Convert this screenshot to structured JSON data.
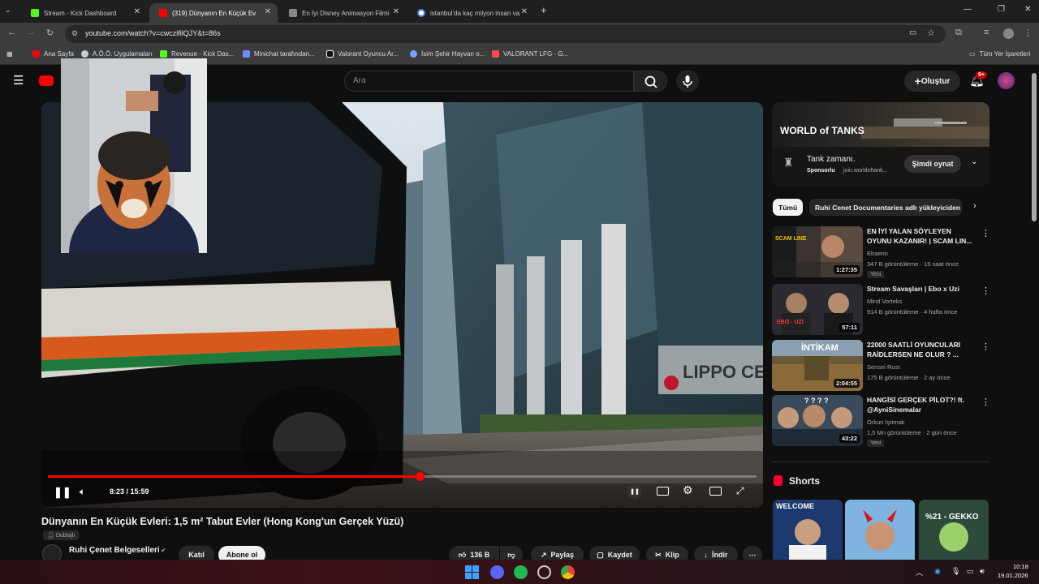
{
  "browser": {
    "tabs": [
      {
        "title": "Stream - Kick Dashboard",
        "color": "#53fc18",
        "active": false
      },
      {
        "title": "(319) Dünyanın En Küçük Ev",
        "color": "#ff0000",
        "active": true
      },
      {
        "title": "En İyi Disney Animasyon Filmi",
        "color": "#888888",
        "active": false
      },
      {
        "title": "istanbul'da kaç milyon insan va",
        "color": "#4285f4",
        "active": false
      }
    ],
    "url": "youtube.com/watch?v=cwczifilQJY&t=86s",
    "bookmarks": [
      {
        "label": "Ana Sayfa",
        "color": "#e50914"
      },
      {
        "label": "A.Ö.Ö. Uygulamaları",
        "color": "#cccccc"
      },
      {
        "label": "Revenue - Kick Das...",
        "color": "#53fc18"
      },
      {
        "label": "Minichat tarafından...",
        "color": "#6f8cff"
      },
      {
        "label": "Valorant Oyuncu Ar...",
        "color": "#ffffff"
      },
      {
        "label": "İsim Şehir Hayvan o...",
        "color": "#7aa0ff"
      },
      {
        "label": "VALORANT LFG - G...",
        "color": "#ff4655"
      }
    ],
    "all_bookmarks": "Tüm Yer İşaretleri"
  },
  "youtube": {
    "search_placeholder": "Ara",
    "create_label": "Oluştur",
    "notif_badge": "9+"
  },
  "player": {
    "time": "8:23 / 15:59",
    "progress": 0.525
  },
  "video": {
    "title": "Dünyanın En Küçük Evleri: 1,5 m² Tabut Evler (Hong Kong'un Gerçek Yüzü)",
    "dubbed": "Dublajlı",
    "channel": "Ruhi Çenet Belgeselleri",
    "join": "Katıl",
    "subscribe": "Abone ol",
    "likes": "136 B",
    "share": "Paylaş",
    "save": "Kaydet",
    "clip": "Klip",
    "download": "İndir"
  },
  "ad": {
    "brand": "WORLD of TANKS",
    "headline": "Tank zamanı.",
    "sponsored": "Sponsorlu",
    "domain": "join.worldoftank...",
    "cta": "Şimdi oynat"
  },
  "chips": [
    "Tümü",
    "Ruhi Cenet Documentaries adlı yükleyiciden"
  ],
  "recommendations": [
    {
      "title": "EN İYİ YALAN SÖYLEYEN OYUNU KAZANIR! | SCAM LIN...",
      "channel": "Elraenn",
      "meta": "347 B görüntüleme · 15 saat önce",
      "badge": "Yeni",
      "duration": "1:27:35",
      "thumb_text": "SCAM LINE"
    },
    {
      "title": "Stream Savaşları | Ebo x Uzi",
      "channel": "Mind Vorteks",
      "meta": "914 B görüntüleme · 4 hafta önce",
      "badge": "",
      "duration": "57:11",
      "thumb_text": "EBO - UZI"
    },
    {
      "title": "22000 SAATLİ OYUNCULARI RAİDLERSEN NE OLUR ? ...",
      "channel": "Sensei Rust",
      "meta": "175 B görüntüleme · 2 ay önce",
      "badge": "",
      "duration": "2:04:55",
      "thumb_text": "İNTİKAM"
    },
    {
      "title": "HANGİSİ GERÇEK PİLOT?! ft. @AyniSinemalar",
      "channel": "Orkun Işıtmak",
      "meta": "1,5 Mn görüntüleme · 2 gün önce",
      "badge": "Yeni",
      "duration": "43:22",
      "thumb_text": "? ? ? ?"
    }
  ],
  "shorts": {
    "title": "Shorts",
    "items": [
      {
        "text": "WELCOME"
      },
      {
        "text": ""
      },
      {
        "text": "%21 - GEKKO"
      }
    ]
  },
  "taskbar": {
    "time": "10:18",
    "date": "19.01.2026"
  }
}
